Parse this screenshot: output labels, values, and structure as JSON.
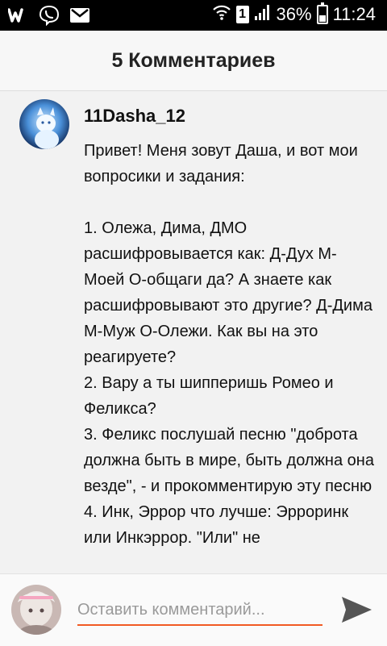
{
  "status_bar": {
    "app_icons": [
      "wattpad-icon",
      "viber-icon",
      "gmail-icon"
    ],
    "sim_label": "1",
    "battery_text": "36%",
    "battery_level": 0.36,
    "time": "11:24"
  },
  "header": {
    "title": "5 Комментариев"
  },
  "comment": {
    "username": "11Dasha_12",
    "text": "Привет! Меня зовут Даша, и вот мои вопросики и задания:\n\n1. Олежа, Дима, ДМО расшифровывается как: Д-Дух М-Моей О-общаги да? А знаете как расшифровывают это другие? Д-Дима М-Муж О-Олежи. Как вы на это реагируете?\n2. Вару а ты шипперишь Ромео и Феликса?\n3. Феликс послушай песню \"доброта должна быть в мире, быть должна она везде\", - и прокомментирую эту песню\n4. Инк, Эррор что лучше: Эрроринк или Инкэррор. \"Или\" не"
  },
  "footer": {
    "input_placeholder": "Оставить комментарий...",
    "accent_color": "#f15a24"
  }
}
